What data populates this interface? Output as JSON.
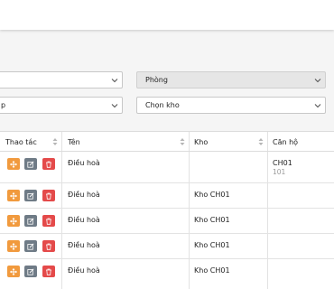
{
  "filters": {
    "room_placeholder": "Phòng",
    "warehouse_placeholder": "Chọn kho",
    "left_partial_text": "p"
  },
  "table": {
    "headers": {
      "actions": "Thao tác",
      "name": "Tên",
      "warehouse": "Kho",
      "apartment": "Căn hộ"
    },
    "rows": [
      {
        "name": "Điều hoà",
        "warehouse": "",
        "apartment": "CH01",
        "apartment_sub": "101"
      },
      {
        "name": "Điều hoà",
        "warehouse": "Kho CH01",
        "apartment": "",
        "apartment_sub": ""
      },
      {
        "name": "Điều hoà",
        "warehouse": "Kho CH01",
        "apartment": "",
        "apartment_sub": ""
      },
      {
        "name": "Điều hoà",
        "warehouse": "Kho CH01",
        "apartment": "",
        "apartment_sub": ""
      },
      {
        "name": "Điều hoà",
        "warehouse": "Kho CH01",
        "apartment": "",
        "apartment_sub": ""
      }
    ]
  },
  "colors": {
    "move_button": "#f19a3e",
    "edit_button": "#6f7b86",
    "delete_button": "#e44a4a"
  },
  "icons": {
    "move": "move-icon",
    "edit": "edit-icon",
    "delete": "trash-icon",
    "dropdown": "chevron-down-icon",
    "sort": "sort-icon"
  }
}
